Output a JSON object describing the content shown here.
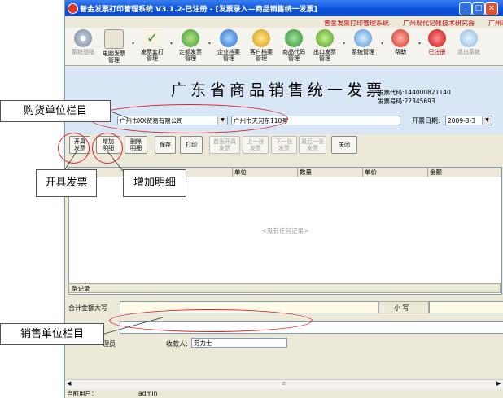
{
  "window": {
    "title": "普金发票打印管理系统 V3.1.2-已注册 - [发票录入—商品销售统一发票]",
    "controls": {
      "minimize": "_",
      "restore": "□",
      "close": "×"
    }
  },
  "infobar": {
    "system_name": "普金发票打印管理系统",
    "company": "广州现代记帐技术研究会",
    "company_cut": "广州i"
  },
  "toolbar": {
    "items": [
      {
        "label": "系统登陆",
        "icon": "disc-icon"
      },
      {
        "label": "电脑发票\n管理",
        "icon": "invoice-icon"
      },
      {
        "label": "发票套打\n管理",
        "icon": "check-icon"
      },
      {
        "label": "定额发票\n管理",
        "icon": "quota-icon"
      },
      {
        "label": "企业档案\n管理",
        "icon": "company-icon"
      },
      {
        "label": "客户档案\n管理",
        "icon": "customer-icon"
      },
      {
        "label": "商品代码\n管理",
        "icon": "goods-icon"
      },
      {
        "label": "出口发票\n管理",
        "icon": "export-icon"
      },
      {
        "label": "系统管理",
        "icon": "system-icon"
      },
      {
        "label": "帮助",
        "icon": "help-icon"
      },
      {
        "label": "已注册",
        "icon": "register-icon"
      },
      {
        "label": "退出系统",
        "icon": "exit-icon"
      }
    ]
  },
  "invoice": {
    "title": "广东省商品销售统一发票",
    "code_label": "发票代码:",
    "code": "144000821140",
    "number_label": "发票号码:",
    "number": "22345693",
    "buyer_name": "广州市XX贸易有限公司",
    "buyer_address": "广州市天河东110号",
    "date_label": "开票日期:",
    "date": "2009-3-3"
  },
  "actions": {
    "issue": "开具\n发票",
    "add": "增加\n明细",
    "delete": "删除\n明细",
    "save": "保存",
    "print": "打印",
    "first": "首张开具\n发票",
    "prev": "上一张\n发票",
    "next": "下一张\n发票",
    "last": "最后一张\n发票",
    "close": "关闭"
  },
  "grid": {
    "columns": [
      "品",
      "单位",
      "数量",
      "单价",
      "金额"
    ],
    "empty_text": "<没有任何记录>",
    "rows_label": "条记录"
  },
  "summary": {
    "amount_upper_label": "合计金额大写",
    "small_label": "小  写"
  },
  "seller": {
    "manager": "理员",
    "payee_label": "收款人:",
    "payee": "劳力士"
  },
  "status": {
    "user_label": "当前用户：",
    "user": "admin"
  },
  "annotations": {
    "buyer_section": "购货单位栏目",
    "issue_invoice": "开具发票",
    "add_detail": "增加明细",
    "seller_section": "销售单位栏目"
  },
  "colors": {
    "title_blue": "#0b54dc",
    "accent_red": "#d9262c",
    "header_bg": "#d9e6f5"
  }
}
